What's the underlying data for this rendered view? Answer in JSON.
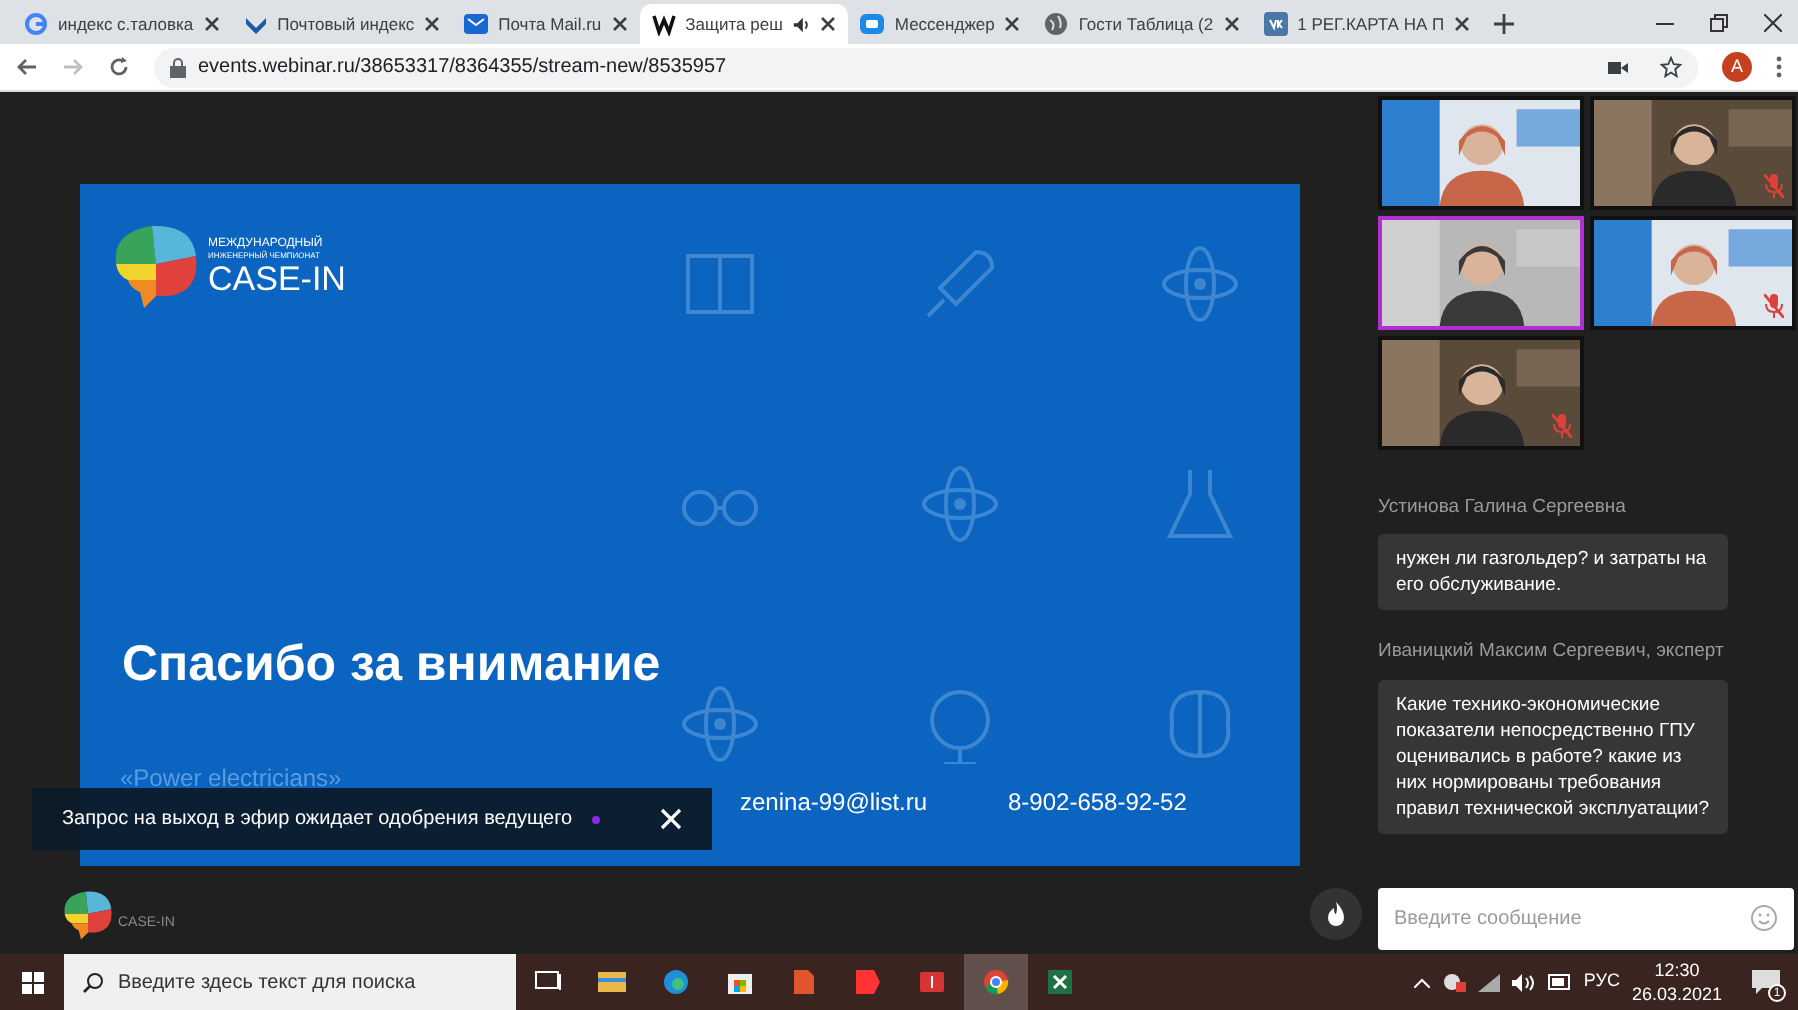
{
  "browser": {
    "tabs": [
      {
        "label": "индекс с.таловка",
        "kind": "google",
        "selected": false,
        "audio": false
      },
      {
        "label": "Почтовый индекс",
        "kind": "post",
        "selected": false,
        "audio": false
      },
      {
        "label": "Почта Mail.ru",
        "kind": "mail",
        "selected": false,
        "audio": false
      },
      {
        "label": "Защита реш",
        "kind": "webinar",
        "selected": true,
        "audio": true
      },
      {
        "label": "Мессенджер",
        "kind": "messenger",
        "selected": false,
        "audio": false
      },
      {
        "label": "Гости Таблица (2",
        "kind": "globe",
        "selected": false,
        "audio": false
      },
      {
        "label": "1 РЕГ.КАРТА НА П",
        "kind": "vk",
        "selected": false,
        "audio": false
      }
    ],
    "url": "events.webinar.ru/38653317/8364355/stream-new/8535957",
    "profile_initial": "А"
  },
  "slide": {
    "logo": {
      "line1": "МЕЖДУНАРОДНЫЙ",
      "line2": "ИНЖЕНЕРНЫЙ ЧЕМПИОНАТ",
      "name": "CASE-IN"
    },
    "title": "Спасибо за внимание",
    "team": "«Power electricians»",
    "email": "zenina-99@list.ru",
    "phone": "8-902-658-92-52"
  },
  "toast": {
    "text": "Запрос на выход в эфир ожидает одобрения ведущего"
  },
  "participants": [
    {
      "muted": false,
      "selected": false
    },
    {
      "muted": true,
      "selected": false
    },
    {
      "muted": false,
      "selected": true
    },
    {
      "muted": true,
      "selected": false
    },
    {
      "muted": true,
      "selected": false
    }
  ],
  "chat": [
    {
      "author": "Устинова Галина Сергеевна",
      "text": "нужен ли газгольдер? и затраты на его обслуживание."
    },
    {
      "author": "Иваницкий Максим Сергеевич, эксперт",
      "text": "Какие технико-экономические показатели непосредственно ГПУ оценивались в работе? какие из них нормированы требования правил технической эксплуатации?"
    }
  ],
  "chat_input": {
    "placeholder": "Введите сообщение"
  },
  "footer_logo": {
    "name": "CASE-IN"
  },
  "taskbar": {
    "search_placeholder": "Введите здесь текст для поиска",
    "language": "РУС",
    "time": "12:30",
    "date": "26.03.2021",
    "notifications": "1"
  }
}
